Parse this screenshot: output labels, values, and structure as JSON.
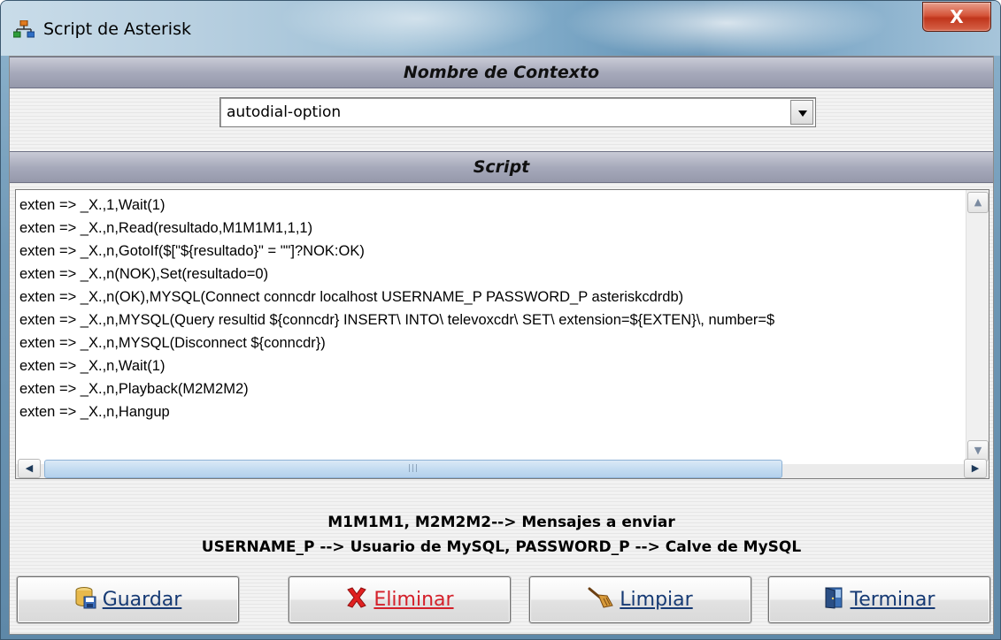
{
  "window": {
    "title": "Script de Asterisk",
    "close_label": "X"
  },
  "context": {
    "header": "Nombre de Contexto",
    "selected": "autodial-option"
  },
  "script": {
    "header": "Script",
    "lines": [
      "exten => _X.,1,Wait(1)",
      "exten => _X.,n,Read(resultado,M1M1M1,1,1)",
      "exten => _X.,n,GotoIf($[\"${resultado}\" = \"\"]?NOK:OK)",
      "exten => _X.,n(NOK),Set(resultado=0)",
      "exten => _X.,n(OK),MYSQL(Connect conncdr localhost USERNAME_P PASSWORD_P asteriskcdrdb)",
      "exten => _X.,n,MYSQL(Query resultid ${conncdr} INSERT\\ INTO\\ televoxcdr\\ SET\\ extension=${EXTEN}\\, number=$",
      "exten => _X.,n,MYSQL(Disconnect ${conncdr})",
      "exten => _X.,n,Wait(1)",
      "exten => _X.,n,Playback(M2M2M2)",
      "exten => _X.,n,Hangup"
    ]
  },
  "info": {
    "line1": "M1M1M1, M2M2M2--> Mensajes a enviar",
    "line2": "USERNAME_P --> Usuario de MySQL, PASSWORD_P --> Calve de MySQL"
  },
  "buttons": {
    "guardar": "Guardar",
    "eliminar": "Eliminar",
    "limpiar": "Limpiar",
    "terminar": "Terminar"
  },
  "icons": {
    "title": "network-tree-icon",
    "guardar": "database-save-icon",
    "eliminar": "red-x-icon",
    "limpiar": "broom-icon",
    "terminar": "door-exit-icon"
  },
  "colors": {
    "header_bg": "#a7aabb",
    "button_text": "#163a74",
    "eliminar_text": "#d4202a",
    "close_button": "#c0351b"
  }
}
